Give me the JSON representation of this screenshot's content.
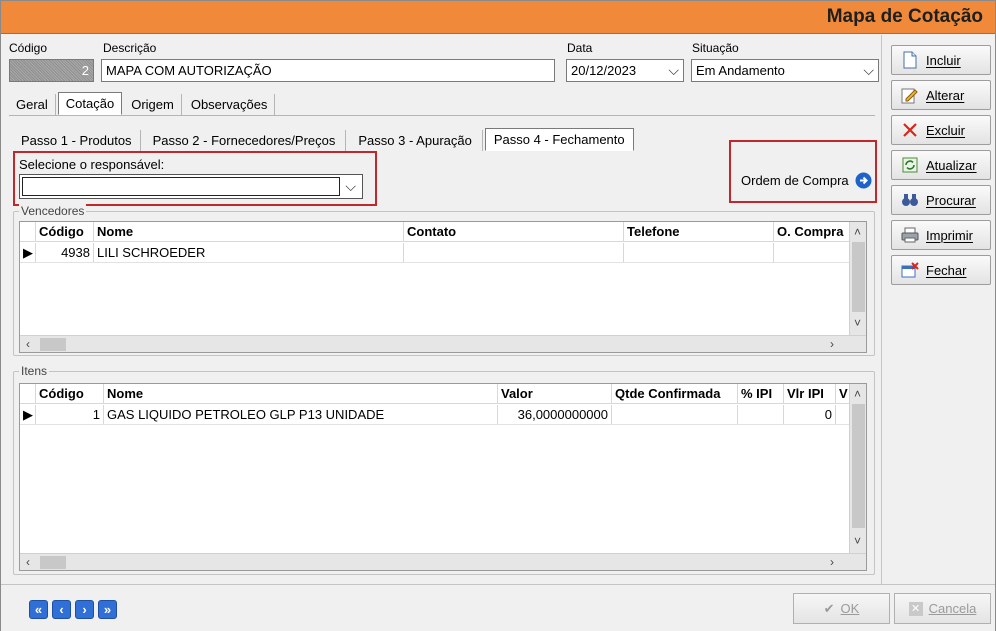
{
  "window": {
    "title": "Mapa de Cotação"
  },
  "header": {
    "codigo_label": "Código",
    "codigo_value": "2",
    "descricao_label": "Descrição",
    "descricao_value": "MAPA COM AUTORIZAÇÃO",
    "data_label": "Data",
    "data_value": "20/12/2023",
    "situacao_label": "Situação",
    "situacao_value": "Em Andamento"
  },
  "tabs": [
    "Geral",
    "Cotação",
    "Origem",
    "Observações"
  ],
  "steps": [
    "Passo 1 - Produtos",
    "Passo 2 - Fornecedores/Preços",
    "Passo 3 - Apuração",
    "Passo 4 - Fechamento"
  ],
  "responsavel": {
    "label": "Selecione o responsável:",
    "value": ""
  },
  "ordem_compra": {
    "label": "Ordem de Compra"
  },
  "vencedores": {
    "title": "Vencedores",
    "columns": [
      "Código",
      "Nome",
      "Contato",
      "Telefone",
      "O. Compra"
    ],
    "rows": [
      {
        "codigo": "4938",
        "nome": "LILI SCHROEDER",
        "contato": "",
        "telefone": "",
        "ocompra": ""
      }
    ]
  },
  "itens": {
    "title": "Itens",
    "columns": [
      "Código",
      "Nome",
      "Valor",
      "Qtde Confirmada",
      "% IPI",
      "Vlr IPI",
      "V"
    ],
    "rows": [
      {
        "codigo": "1",
        "nome": "GAS LIQUIDO PETROLEO GLP P13 UNIDADE",
        "valor": "36,0000000000",
        "qtde": "",
        "ipi": "",
        "vlripi": "0"
      }
    ]
  },
  "side_buttons": {
    "incluir": "Incluir",
    "alterar": "Alterar",
    "excluir": "Excluir",
    "atualizar": "Atualizar",
    "procurar": "Procurar",
    "imprimir": "Imprimir",
    "fechar": "Fechar"
  },
  "nav": {
    "first": "«",
    "prev": "‹",
    "next": "›",
    "last": "»"
  },
  "footer": {
    "ok": "OK",
    "cancela": "Cancela"
  },
  "colors": {
    "title_bar": "#f08a3a",
    "highlight": "#c0282c",
    "nav_blue": "#2f6fd6"
  }
}
